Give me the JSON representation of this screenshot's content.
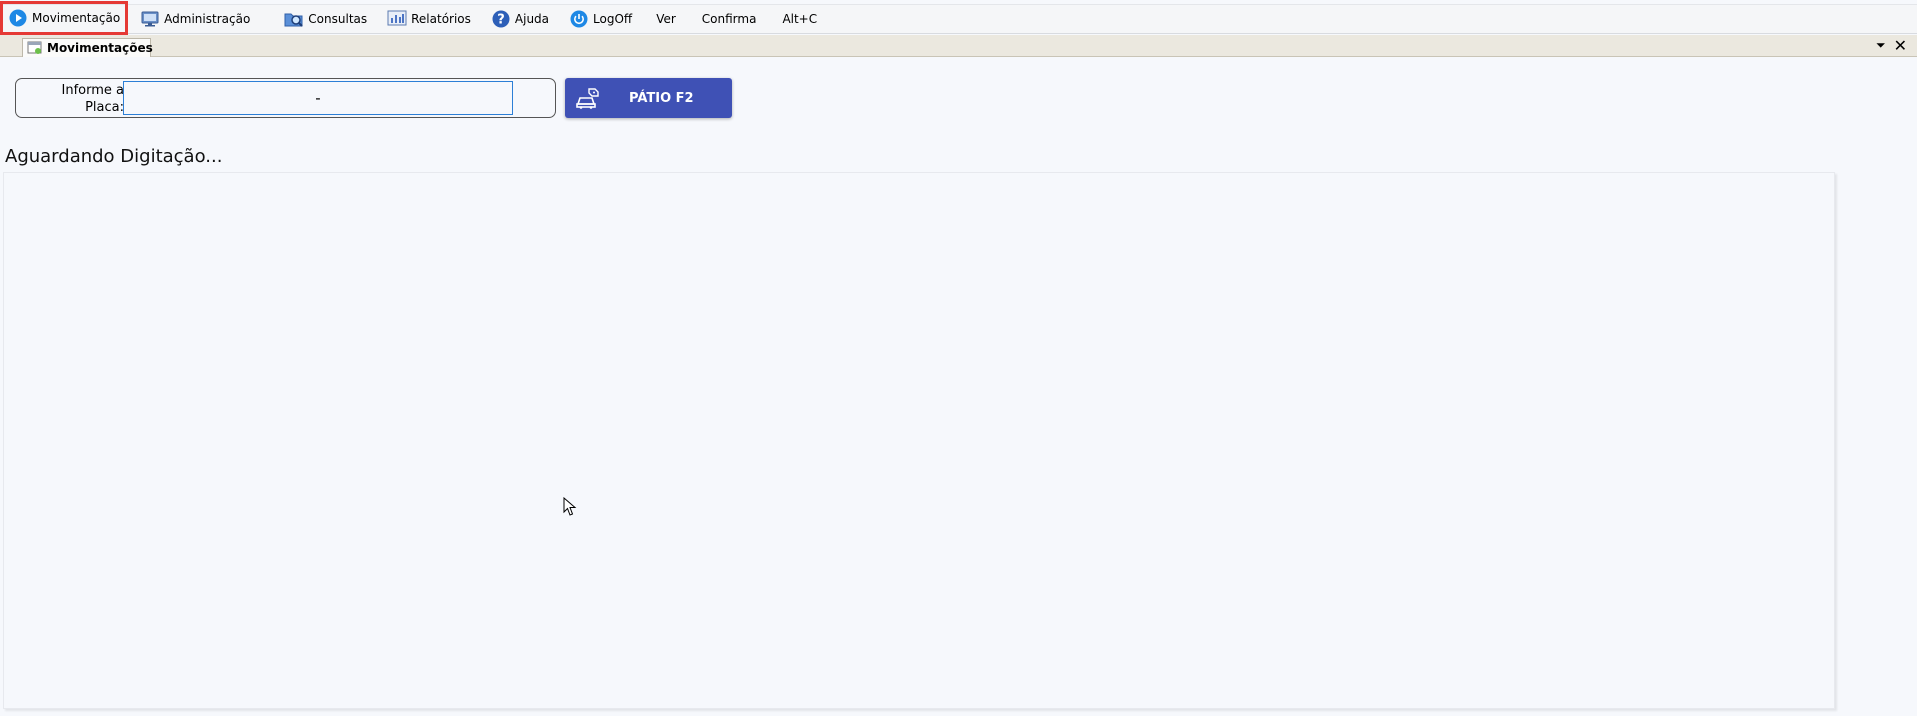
{
  "menubar": {
    "items": [
      {
        "label": "Movimentação",
        "icon": "play-circle-icon"
      },
      {
        "label": "Administração",
        "icon": "admin-monitor-icon"
      },
      {
        "label": "Consultas",
        "icon": "search-folder-icon"
      },
      {
        "label": "Relatórios",
        "icon": "report-chart-icon"
      },
      {
        "label": "Ajuda",
        "icon": "help-question-icon"
      },
      {
        "label": "LogOff",
        "icon": "power-icon"
      },
      {
        "label": "Ver"
      },
      {
        "label": "Confirma"
      },
      {
        "label": "Alt+C"
      }
    ],
    "active_color": "#e53935"
  },
  "tabs": {
    "active_label": "Movimentações",
    "dropdown_glyph": "⏷",
    "close_glyph": "✕"
  },
  "form": {
    "plate_label": "Informe a Placa:",
    "plate_value": "-",
    "patio_button_label": "PÁTIO F2"
  },
  "status": {
    "text": "Aguardando Digitação..."
  },
  "colors": {
    "accent_button": "#3f51b5",
    "input_border": "#2d7fd6",
    "background": "#f6f8fc"
  }
}
